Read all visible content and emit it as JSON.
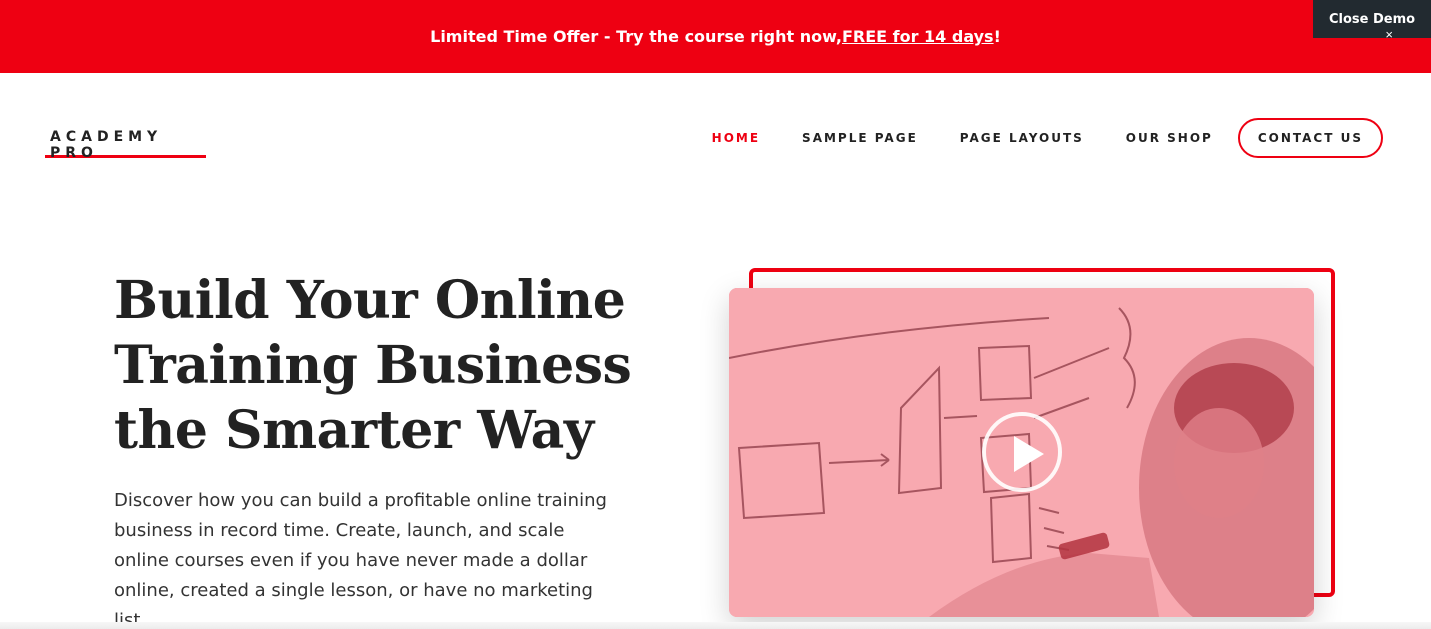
{
  "promo": {
    "text_before": "Limited Time Offer - Try the course right now, ",
    "link_text": "FREE for 14 days",
    "text_after": "!",
    "close_demo_label": "Close Demo",
    "close_icon": "×"
  },
  "header": {
    "logo_text": "ACADEMY PRO",
    "nav": {
      "home": "HOME",
      "sample_page": "SAMPLE PAGE",
      "page_layouts": "PAGE LAYOUTS",
      "our_shop": "OUR SHOP",
      "contact_us": "CONTACT US"
    }
  },
  "hero": {
    "title": "Build Your Online Training Business the Smarter Way",
    "description": "Discover how you can build a profitable online training business in record time. Create, launch, and scale online courses even if you have never made a dollar online, created a single lesson, or have no marketing list."
  },
  "video": {
    "play_icon": "play-icon"
  },
  "colors": {
    "accent": "#ee0012",
    "text": "#222222",
    "close_demo_bg": "#222a30"
  }
}
